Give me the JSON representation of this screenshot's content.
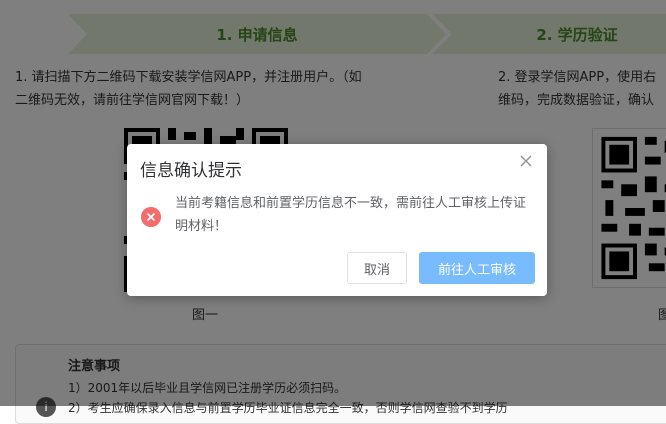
{
  "steps": {
    "step1": "1. 申请信息",
    "step2": "2. 学历验证"
  },
  "instructions": {
    "left_line1": "1. 请扫描下方二维码下载安装学信网APP，并注册用户。（如",
    "left_line2": "二维码无效，请前往学信网官网下载！）",
    "right_line1": "2. 登录学信网APP，使用右",
    "right_line2": "维码，完成数据验证，确认"
  },
  "figures": {
    "fig1": "图一",
    "fig2": "图"
  },
  "notice": {
    "title": "注意事项",
    "item1": "1）2001年以后毕业且学信网已注册学历必须扫码。",
    "item2": "2）考生应确保录入信息与前置学历毕业证信息完全一致，否则学信网查验不到学历"
  },
  "dialog": {
    "title": "信息确认提示",
    "message": "当前考籍信息和前置学历信息不一致，需前往人工审核上传证明材料！",
    "cancel_label": "取消",
    "confirm_label": "前往人工审核"
  },
  "icons": {
    "close": "close-icon",
    "error": "error-icon"
  },
  "colors": {
    "step_bg": "#e4f2d8",
    "step_text": "#4b8a2b",
    "error": "#f56c6c",
    "primary": "#79bbff"
  }
}
